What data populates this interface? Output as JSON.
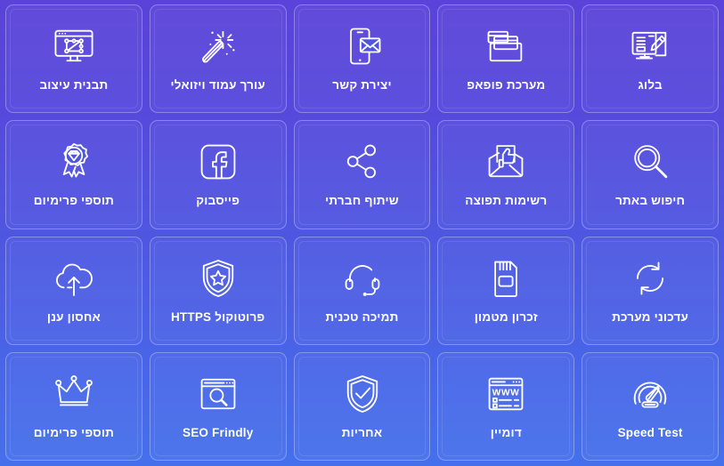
{
  "page": {
    "title": "",
    "direction": "rtl",
    "background_gradient_start": "#5b42d9",
    "background_gradient_end": "#4570ec",
    "label_color": "#ffffff",
    "icon_color": "#ffffff",
    "card_border_color": "rgba(255,255,255,0.30)",
    "columns": 5,
    "rows": 4
  },
  "grid": {
    "items": [
      {
        "label": "בלוג",
        "icon": "blog-monitor-pencil-icon"
      },
      {
        "label": "מערכת פופאפ",
        "icon": "popup-windows-icon"
      },
      {
        "label": "יצירת קשר",
        "icon": "mobile-envelope-icon"
      },
      {
        "label": "עורך עמוד ויזואלי",
        "icon": "magic-wand-icon"
      },
      {
        "label": "תבנית עיצוב",
        "icon": "design-template-monitor-icon"
      },
      {
        "label": "חיפוש באתר",
        "icon": "magnifier-icon"
      },
      {
        "label": "רשימות תפוצה",
        "icon": "envelope-thumbs-up-icon"
      },
      {
        "label": "שיתוף חברתי",
        "icon": "share-nodes-icon"
      },
      {
        "label": "פייסבוק",
        "icon": "facebook-icon"
      },
      {
        "label": "תוספי פרימיום",
        "icon": "award-ribbon-diamond-icon"
      },
      {
        "label": "עדכוני מערכת",
        "icon": "refresh-circular-arrows-icon"
      },
      {
        "label": "זכרון מטמון",
        "icon": "memory-card-icon"
      },
      {
        "label": "תמיכה טכנית",
        "icon": "headset-support-icon"
      },
      {
        "label": "פרוטוקול HTTPS",
        "icon": "shield-star-icon"
      },
      {
        "label": "אחסון ענן",
        "icon": "cloud-upload-icon"
      },
      {
        "label": "Speed Test",
        "icon": "speedometer-icon"
      },
      {
        "label": "דומיין",
        "icon": "browser-www-icon"
      },
      {
        "label": "אחריות",
        "icon": "shield-check-icon"
      },
      {
        "label": "SEO Frindly",
        "icon": "browser-search-icon"
      },
      {
        "label": "תוספי פרימיום",
        "icon": "crown-icon"
      }
    ]
  }
}
